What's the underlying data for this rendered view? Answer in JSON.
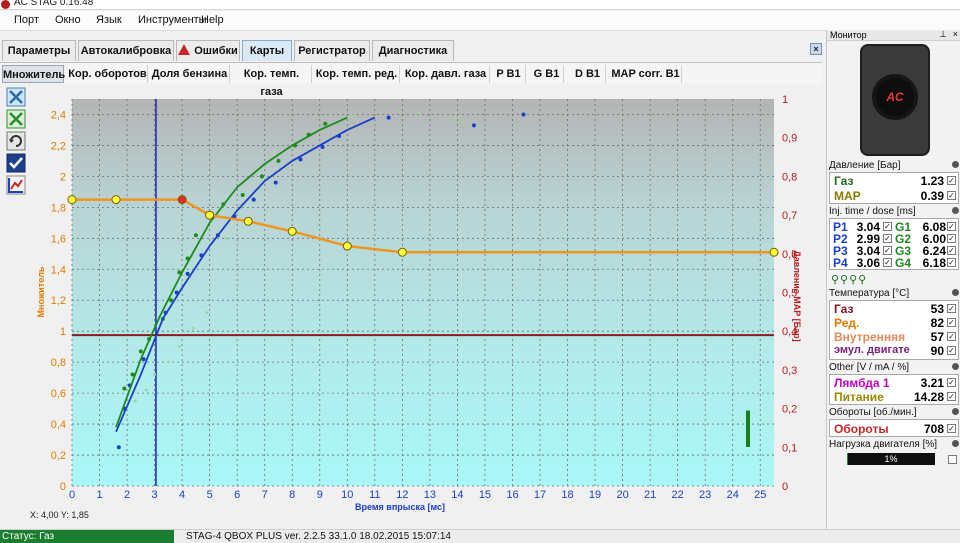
{
  "window": {
    "title": "AC STAG 0.16.48"
  },
  "menu": [
    "Порт",
    "Окно",
    "Язык",
    "Инструменты",
    "Help"
  ],
  "tabs": [
    {
      "label": "Параметры",
      "active": false
    },
    {
      "label": "Автокалибровка",
      "active": false
    },
    {
      "label": "Ошибки",
      "active": false,
      "icon": "warning-icon"
    },
    {
      "label": "Карты",
      "active": true
    },
    {
      "label": "Регистратор",
      "active": false
    },
    {
      "label": "Диагностика",
      "active": false
    }
  ],
  "subtabs": [
    {
      "label": "Множитель",
      "active": true
    },
    {
      "label": "Кор. оборотов"
    },
    {
      "label": "Доля бензина"
    },
    {
      "label": "Кор. темп. газа"
    },
    {
      "label": "Кор. темп. ред."
    },
    {
      "label": "Кор. давл. газа"
    },
    {
      "label": "P B1"
    },
    {
      "label": "G B1"
    },
    {
      "label": "D B1"
    },
    {
      "label": "MAP corr. B1"
    }
  ],
  "tools": [
    "zoom-icon",
    "reset-icon",
    "refresh-icon",
    "check-icon",
    "chart-toggle-icon"
  ],
  "cursor_readout": "X: 4,00  Y: 1,85",
  "status": {
    "left": "Статус: Газ",
    "device": "STAG-4 QBOX PLUS  ver. 2.2.5  33.1.0  18.02.2015 15:07:14"
  },
  "monitor": {
    "title": "Монитор",
    "pressure_header": "Давление [Бар]",
    "pressure": [
      {
        "label": "Газ",
        "value": "1.23",
        "color": "#1e6b1e"
      },
      {
        "label": "MAP",
        "value": "0.39",
        "color": "#8a7a00"
      }
    ],
    "inj_header": "Inj. time / dose [ms]",
    "inj": [
      {
        "p": "P1",
        "pv": "3.04",
        "g": "G1",
        "gv": "6.08"
      },
      {
        "p": "P2",
        "pv": "2.99",
        "g": "G2",
        "gv": "6.00"
      },
      {
        "p": "P3",
        "pv": "3.04",
        "g": "G3",
        "gv": "6.24"
      },
      {
        "p": "P4",
        "pv": "3.06",
        "g": "G4",
        "gv": "6.18"
      }
    ],
    "temp_header": "Температура [°C]",
    "temps": [
      {
        "label": "Газ",
        "value": "53",
        "color": "#7a1520"
      },
      {
        "label": "Ред.",
        "value": "82",
        "color": "#e07b00"
      },
      {
        "label": "Внутренняя",
        "value": "57",
        "color": "#e08a5a"
      },
      {
        "label": "эмул. двигате",
        "value": "90",
        "color": "#7a1f7a"
      }
    ],
    "other_header": "Other [V / mA / %]",
    "other": [
      {
        "label": "Лямбда 1",
        "value": "3.21",
        "color": "#c400c4"
      },
      {
        "label": "Питание",
        "value": "14.28",
        "color": "#9a8a00"
      }
    ],
    "rpm_header": "Обороты [об./мин.]",
    "rpm": {
      "label": "Обороты",
      "value": "708",
      "color": "#c62828"
    },
    "load_header": "Нагрузка двигателя [%]",
    "load": {
      "value": "1%",
      "fraction": 0.01
    }
  },
  "chart_data": {
    "type": "line",
    "xlabel": "Время впрыска [мс]",
    "ylabel_left": "Множитель",
    "ylabel_right": "Давление MAP [Бар]",
    "x_ticks": [
      "0",
      "1",
      "2",
      "3",
      "4",
      "5",
      "6",
      "7",
      "8",
      "9",
      "10",
      "11",
      "12",
      "13",
      "14",
      "15",
      "16",
      "17",
      "18",
      "19",
      "20",
      "21",
      "22",
      "23",
      "24",
      "25"
    ],
    "y_left_ticks": [
      "0",
      "0,2",
      "0,4",
      "0,6",
      "0,8",
      "1",
      "1,2",
      "1,4",
      "1,6",
      "1,8",
      "2",
      "2,2",
      "2,4"
    ],
    "y_right_ticks": [
      "0",
      "0,1",
      "0,2",
      "0,3",
      "0,4",
      "0,5",
      "0,6",
      "0,7",
      "0,8",
      "0,9",
      "1"
    ],
    "xlim": [
      0,
      25.5
    ],
    "ylim_left": [
      0,
      2.5
    ],
    "ylim_right": [
      0,
      1
    ],
    "grid": true,
    "multiplier_points": [
      {
        "x": 0,
        "y": 1.85
      },
      {
        "x": 1.6,
        "y": 1.85
      },
      {
        "x": 4.0,
        "y": 1.85,
        "selected": true
      },
      {
        "x": 5.0,
        "y": 1.75
      },
      {
        "x": 6.4,
        "y": 1.71
      },
      {
        "x": 8.0,
        "y": 1.645
      },
      {
        "x": 10.0,
        "y": 1.55
      },
      {
        "x": 12.0,
        "y": 1.51
      },
      {
        "x": 25.5,
        "y": 1.51
      }
    ],
    "cursor_x": 3.05,
    "map_pressure_line": 0.975,
    "map_bar_level": 0.195,
    "series": [
      {
        "name": "green",
        "color": "#1e8a1e",
        "x": [
          1.6,
          2.5,
          3.2,
          4.0,
          5.0,
          6.0,
          7.0,
          8.0,
          9.0,
          10.0
        ],
        "y": [
          0.38,
          0.82,
          1.1,
          1.38,
          1.7,
          1.93,
          2.08,
          2.2,
          2.3,
          2.38
        ]
      },
      {
        "name": "blue",
        "color": "#1a3fc8",
        "x": [
          1.6,
          2.5,
          3.3,
          4.0,
          5.0,
          6.0,
          7.0,
          8.0,
          9.0,
          10.0,
          11.0
        ],
        "y": [
          0.35,
          0.72,
          1.08,
          1.28,
          1.55,
          1.78,
          1.97,
          2.1,
          2.2,
          2.3,
          2.38
        ]
      }
    ],
    "scatter_green": [
      [
        1.9,
        0.63
      ],
      [
        2.2,
        0.72
      ],
      [
        2.5,
        0.87
      ],
      [
        2.8,
        0.95
      ],
      [
        3.3,
        1.08
      ],
      [
        3.6,
        1.2
      ],
      [
        3.9,
        1.38
      ],
      [
        4.2,
        1.47
      ],
      [
        4.5,
        1.62
      ],
      [
        5.0,
        1.75
      ],
      [
        5.5,
        1.82
      ],
      [
        6.2,
        1.88
      ],
      [
        6.9,
        2.0
      ],
      [
        7.5,
        2.1
      ],
      [
        8.1,
        2.2
      ],
      [
        8.6,
        2.27
      ],
      [
        9.2,
        2.34
      ]
    ],
    "scatter_blue": [
      [
        1.7,
        0.25
      ],
      [
        1.9,
        0.5
      ],
      [
        2.1,
        0.65
      ],
      [
        2.6,
        0.82
      ],
      [
        3.4,
        1.12
      ],
      [
        3.8,
        1.25
      ],
      [
        4.2,
        1.37
      ],
      [
        4.7,
        1.49
      ],
      [
        5.3,
        1.62
      ],
      [
        5.9,
        1.74
      ],
      [
        6.6,
        1.85
      ],
      [
        7.4,
        1.96
      ],
      [
        8.3,
        2.11
      ],
      [
        9.1,
        2.19
      ],
      [
        9.7,
        2.26
      ],
      [
        11.5,
        2.38
      ],
      [
        14.6,
        2.33
      ],
      [
        16.4,
        2.4
      ]
    ],
    "light_points": [
      [
        2.3,
        0.55
      ],
      [
        2.7,
        0.62
      ],
      [
        3.0,
        0.72
      ],
      [
        3.5,
        0.8
      ],
      [
        3.9,
        0.9
      ],
      [
        4.4,
        1.02
      ],
      [
        4.9,
        1.12
      ],
      [
        5.6,
        1.6
      ],
      [
        6.8,
        1.92
      ],
      [
        7.8,
        2.05
      ],
      [
        10.2,
        2.39
      ],
      [
        11.9,
        2.42
      ],
      [
        12.6,
        2.41
      ],
      [
        13.9,
        2.38
      ],
      [
        14.2,
        2.35
      ]
    ]
  }
}
